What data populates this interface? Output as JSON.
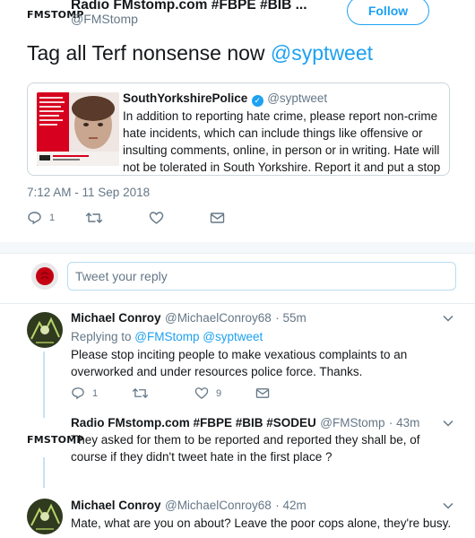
{
  "header": {
    "logo_text": "FMSTOMP",
    "display_name": "Radio FMstomp.com #FBPE #BIB ...",
    "handle": "@FMStomp",
    "follow_label": "Follow"
  },
  "main_tweet": {
    "text": "Tag all Terf nonsense now ",
    "mention": "@syptweet",
    "timestamp": "7:12 AM - 11 Sep 2018",
    "reply_count": "1",
    "retweet_count": "",
    "like_count": ""
  },
  "quote": {
    "name": "SouthYorkshirePolice",
    "handle": "@syptweet",
    "verified_glyph": "✓",
    "text": "In addition to reporting hate crime, please report non-crime hate incidents, which can include things like offensive or insulting comments, online, in person or in writing. Hate will not be tolerated in South Yorkshire. Report it and put a stop to it #HateHurtsSY"
  },
  "reply_box": {
    "placeholder": "Tweet your reply"
  },
  "replies": [
    {
      "name": "Michael Conroy",
      "handle": "@MichaelConroy68",
      "time": "· 55m",
      "replying_prefix": "Replying to ",
      "replying_to": "@FMStomp @syptweet",
      "text": "Please stop inciting people to make vexatious complaints to an overworked and under resources police force. Thanks.",
      "reply_count": "1",
      "retweet_count": "",
      "like_count": "9"
    },
    {
      "name": "Radio FMstomp.com #FBPE #BIB #SODEU",
      "handle": "@FMStomp",
      "time": "· 43m",
      "logo_text": "FMSTOMP",
      "text": "They asked for them to be reported and reported they shall be, of course if they didn't tweet hate in the first place ?"
    },
    {
      "name": "Michael Conroy",
      "handle": "@MichaelConroy68",
      "time": "· 42m",
      "text": "Mate, what are you on about? Leave the poor cops alone, they're busy."
    }
  ],
  "icons": {
    "reply": "reply-icon",
    "retweet": "retweet-icon",
    "like": "heart-icon",
    "dm": "envelope-icon",
    "more": "chevron-down-icon"
  },
  "colors": {
    "accent": "#1da1f2",
    "muted": "#657786",
    "border": "#e6ecf0"
  }
}
